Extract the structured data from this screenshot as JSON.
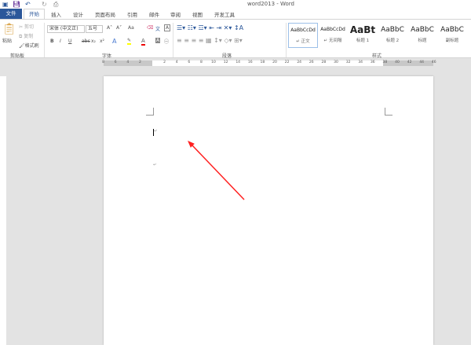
{
  "window": {
    "title": "word2013 - Word"
  },
  "tabs": {
    "file": "文件",
    "items": [
      "开始",
      "插入",
      "设计",
      "页面布局",
      "引用",
      "邮件",
      "审阅",
      "视图",
      "开发工具"
    ]
  },
  "clipboard": {
    "paste": "粘贴",
    "cut": "剪切",
    "copy": "复制",
    "format_painter": "格式刷",
    "group": "剪贴板"
  },
  "font": {
    "name": "宋体 (中文正)",
    "size": "五号",
    "bold": "B",
    "italic": "I",
    "underline": "U",
    "strike": "abc",
    "sub": "x₂",
    "sup": "x²",
    "case": "Aa",
    "group": "字体"
  },
  "paragraph": {
    "group": "段落"
  },
  "styles": {
    "group": "样式",
    "items": [
      {
        "preview": "AaBbCcDd",
        "name": "↵ 正文"
      },
      {
        "preview": "AaBbCcDd",
        "name": "↵ 无间隔"
      },
      {
        "preview": "AaBt",
        "name": "标题 1"
      },
      {
        "preview": "AaBbC",
        "name": "标题 2"
      },
      {
        "preview": "AaBbC",
        "name": "标题"
      },
      {
        "preview": "AaBbC",
        "name": "副标题"
      }
    ]
  },
  "ruler": {
    "left": [
      "8",
      "6",
      "4",
      "2"
    ],
    "main": [
      "2",
      "4",
      "6",
      "8",
      "10",
      "12",
      "14",
      "16",
      "18",
      "20",
      "22",
      "24",
      "26",
      "28",
      "30",
      "32",
      "34",
      "36",
      "38"
    ],
    "right": [
      "40",
      "42",
      "44",
      "46"
    ]
  },
  "document": {
    "para_mark": "↵"
  },
  "colors": {
    "accent": "#2b579a",
    "arrow": "#ff2020"
  }
}
